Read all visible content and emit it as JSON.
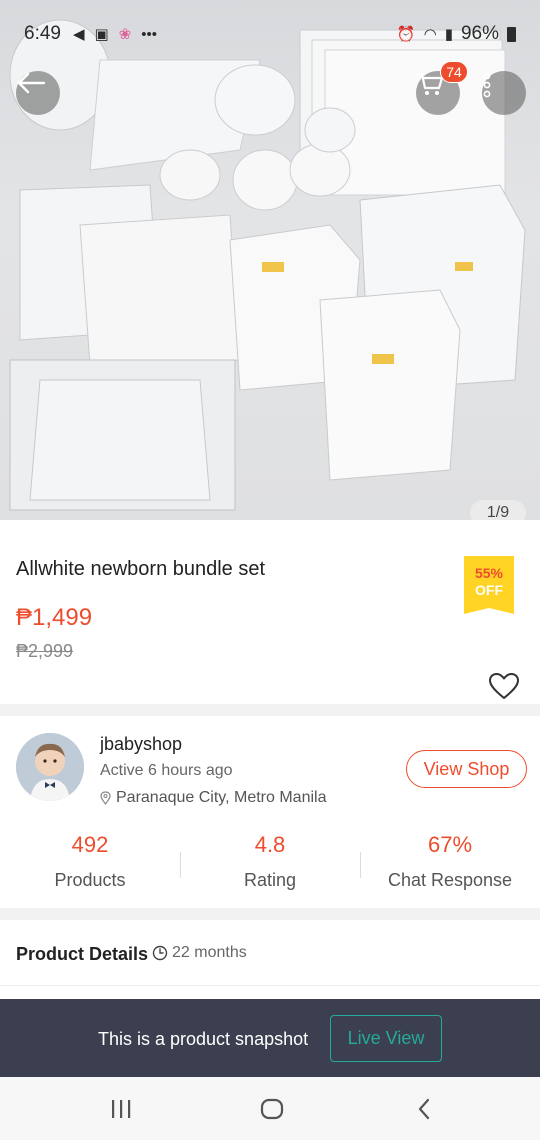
{
  "status_bar": {
    "time": "6:49",
    "battery": "96%",
    "icons": [
      "navigation-icon",
      "image-icon",
      "app-notification-icon",
      "more-dots-icon",
      "alarm-icon",
      "wifi-icon",
      "signal-icon",
      "battery-icon"
    ]
  },
  "hero": {
    "counter": "1/9",
    "cart_badge": "74"
  },
  "product": {
    "title": "Allwhite newborn bundle set",
    "price": "₱1,499",
    "original_price": "₱2,999",
    "discount_percent": "55%",
    "discount_label": "OFF"
  },
  "shop": {
    "name": "jbabyshop",
    "active": "Active 6 hours ago",
    "location": "Paranaque City, Metro Manila",
    "view_shop_label": "View Shop",
    "stats": [
      {
        "value": "492",
        "label": "Products"
      },
      {
        "value": "4.8",
        "label": "Rating"
      },
      {
        "value": "67%",
        "label": "Chat Response"
      }
    ]
  },
  "details": {
    "title": "Product Details",
    "age": "22 months"
  },
  "snapshot": {
    "text": "This is a product snapshot",
    "live_view_label": "Live View"
  },
  "colors": {
    "accent": "#ee4d2d",
    "badge_yellow": "#ffd424",
    "banner": "#3b3f4f",
    "teal": "#26aa99"
  }
}
